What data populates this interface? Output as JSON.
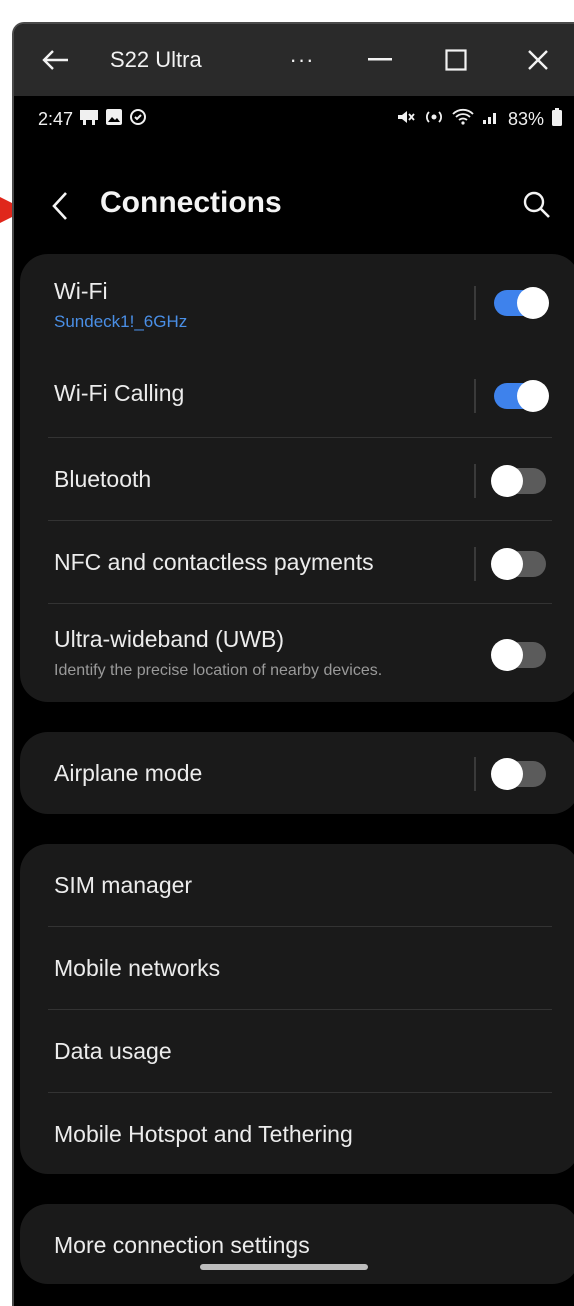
{
  "window": {
    "title": "S22 Ultra",
    "more": "···"
  },
  "status": {
    "time": "2:47",
    "battery": "83%"
  },
  "header": {
    "title": "Connections"
  },
  "card1": {
    "wifi": {
      "label": "Wi-Fi",
      "sub": "Sundeck1!_6GHz",
      "on": true
    },
    "wifi_calling": {
      "label": "Wi-Fi Calling",
      "on": true
    },
    "bluetooth": {
      "label": "Bluetooth",
      "on": false
    },
    "nfc": {
      "label": "NFC and contactless payments",
      "on": false
    },
    "uwb": {
      "label": "Ultra-wideband (UWB)",
      "sub": "Identify the precise location of nearby devices.",
      "on": false
    }
  },
  "card2": {
    "airplane": {
      "label": "Airplane mode",
      "on": false
    }
  },
  "card3": {
    "items": [
      "SIM manager",
      "Mobile networks",
      "Data usage",
      "Mobile Hotspot and Tethering"
    ]
  },
  "card4": {
    "more": "More connection settings"
  },
  "colors": {
    "accent": "#3e82ec",
    "link": "#4a8fe6",
    "annotation": "#e0271b"
  }
}
